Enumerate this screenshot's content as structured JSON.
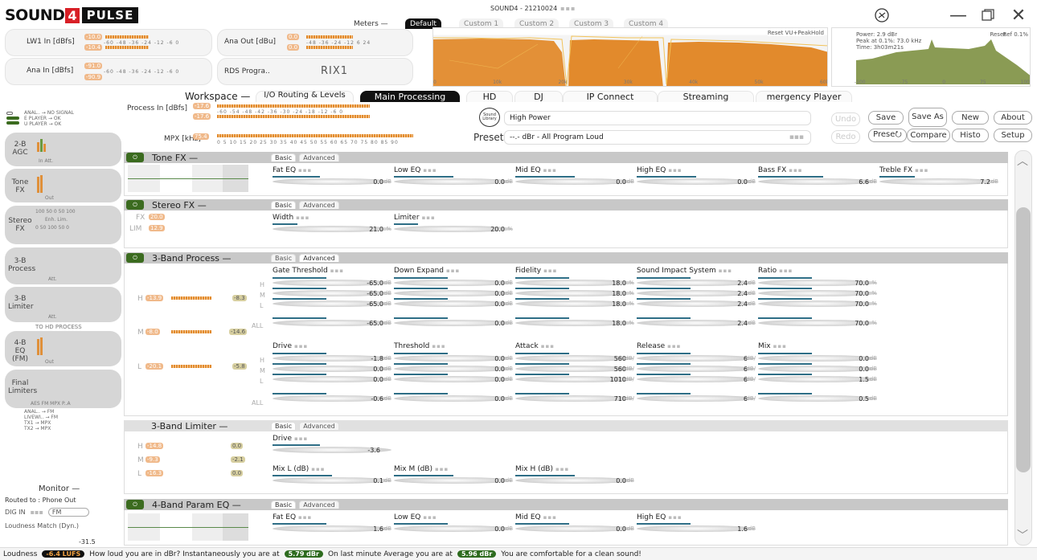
{
  "app": {
    "logo_left": "SOUND",
    "logo_four": "4",
    "logo_right": "PULSE",
    "window_title": "SOUND4 - 21210024"
  },
  "meters": {
    "lw1_label": "LW1 In [dBfs]",
    "lw1_a": "-10.0",
    "lw1_b": "-10.4",
    "ana_in_label": "Ana In [dBfs]",
    "ana_in_a": "-91.0",
    "ana_in_b": "-90.9",
    "ana_out_label": "Ana Out [dBu]",
    "ana_out_a": "0.0",
    "ana_out_b": "0.0",
    "rds_label": "RDS Progra..",
    "rds_value": "RIX1",
    "menu_label": "Meters —",
    "tabs": [
      "Default",
      "Custom 1",
      "Custom 2",
      "Custom 3",
      "Custom 4"
    ],
    "spec1_reset": "Reset VU+PeakHold",
    "spec1_x": [
      "0",
      "10k",
      "20k",
      "30k",
      "40k",
      "50k",
      "60k"
    ],
    "spec2_power": "Power: 2.9 dBr",
    "spec2_peak": "Peak at 0.1%: 73.0 kHz",
    "spec2_time": "Time: 3h03m21s",
    "spec2_reset": "Reset",
    "spec2_ref": "Ref 0.1%",
    "spec2_x": [
      "-100",
      "-75",
      "0",
      "75",
      "100"
    ]
  },
  "workspace": {
    "label": "Workspace —",
    "tabs": [
      "I/O Routing & Levels",
      "Main Processing",
      "HD",
      "DJ",
      "IP Connect",
      "Streaming",
      "mergency Player"
    ],
    "active": "Main Processing"
  },
  "process": {
    "process_in": "Process In [dBfs]",
    "pi_a": "-17.6",
    "pi_b": "-17.6",
    "mpx_label": "MPX [kHz]",
    "mpx_val": "75.4",
    "library_label": "Sound Library",
    "library_value": "High Power",
    "preset_label": "Preset",
    "preset_value": "--.- dBr - All Program Loud"
  },
  "buttons": {
    "undo": "Undo",
    "redo": "Redo",
    "save": "Save",
    "save_as": "Save As",
    "preset": "Prese⭮",
    "compare": "Compare",
    "new": "New",
    "histo": "Histo",
    "about": "About",
    "setup": "Setup"
  },
  "left": {
    "routing_top": [
      "ANAL.. → NO SIGNAL",
      "E PLAYER → OK",
      "U PLAYER → OK"
    ],
    "blocks": [
      {
        "title": "2-B AGC",
        "foot": "In    Att."
      },
      {
        "title": "Tone FX",
        "foot": "Out"
      },
      {
        "title": "Stereo FX",
        "foot": "Enh.  Lim."
      },
      {
        "title": "3-B Process",
        "foot": "Att."
      },
      {
        "title": "3-B Limiter",
        "foot": "Att."
      },
      {
        "title": "4-B EQ (FM)",
        "foot": "Out"
      },
      {
        "title": "Final Limiters",
        "foot": "AES FM   MPX P..A"
      }
    ],
    "to_hd": "TO HD PROCESS",
    "routing_bottom": [
      "ANAL.. → FM",
      "LIVEWI.. → FM",
      "TX1 → MPX",
      "TX2 → MPX"
    ]
  },
  "monitor": {
    "label": "Monitor —",
    "routed": "Routed to : Phone Out",
    "dig_in": "DIG IN",
    "fm": "FM",
    "loudness": "Loudness Match (Dyn.)",
    "level": "-31.5"
  },
  "tone_fx": {
    "title": "Tone FX —",
    "subtabs": [
      "Basic",
      "Advanced"
    ],
    "params": [
      {
        "label": "Fat EQ",
        "value": "0.0",
        "unit": "dB",
        "fill": 0.4
      },
      {
        "label": "Low EQ",
        "value": "0.0",
        "unit": "dB",
        "fill": 0.5
      },
      {
        "label": "Mid EQ",
        "value": "0.0",
        "unit": "dB",
        "fill": 0.5
      },
      {
        "label": "High EQ",
        "value": "0.0",
        "unit": "dB",
        "fill": 0.5
      },
      {
        "label": "Bass FX",
        "value": "6.6",
        "unit": "dB",
        "fill": 0.55
      },
      {
        "label": "Treble FX",
        "value": "7.2",
        "unit": "dB",
        "fill": 0.3
      }
    ]
  },
  "stereo_fx": {
    "title": "Stereo FX —",
    "subtabs": [
      "Basic",
      "Advanced"
    ],
    "fx_label": "FX",
    "fx_val": "20.0",
    "lim_label": "LIM",
    "lim_val": "12.9",
    "params": [
      {
        "label": "Width",
        "value": "21.0",
        "unit": "%",
        "fill": 0.21
      },
      {
        "label": "Limiter",
        "value": "20.0",
        "unit": "%",
        "fill": 0.2
      }
    ]
  },
  "band3_process": {
    "title": "3-Band Process —",
    "subtabs": [
      "Basic",
      "Advanced"
    ],
    "row_labels": [
      "H",
      "M",
      "L",
      "ALL"
    ],
    "h_val": "-13.9",
    "h_gain": "-8.3",
    "m_val": "-8.0",
    "m_gain": "-14.6",
    "l_val": "-20.1",
    "l_gain": "-5.8",
    "group1": [
      {
        "label": "Gate Threshold",
        "values": [
          "-65.0",
          "-65.0",
          "-65.0",
          "-65.0"
        ],
        "unit": "dB"
      },
      {
        "label": "Down Expand",
        "values": [
          "0.0",
          "0.0",
          "0.0",
          "0.0"
        ],
        "unit": "dB"
      },
      {
        "label": "Fidelity",
        "values": [
          "18.0",
          "18.0",
          "18.0",
          "18.0"
        ],
        "unit": "%"
      },
      {
        "label": "Sound Impact System",
        "values": [
          "2.4",
          "2.4",
          "2.4",
          "2.4"
        ],
        "unit": "dB"
      },
      {
        "label": "Ratio",
        "values": [
          "70.0",
          "70.0",
          "70.0",
          "70.0"
        ],
        "unit": "%"
      }
    ],
    "group2": [
      {
        "label": "Drive",
        "values": [
          "-1.8",
          "0.0",
          "0.0",
          "-0.6"
        ],
        "unit": "dB"
      },
      {
        "label": "Threshold",
        "values": [
          "0.0",
          "0.0",
          "0.0",
          "0.0"
        ],
        "unit": "dB"
      },
      {
        "label": "Attack",
        "values": [
          "560",
          "560",
          "1010",
          "710"
        ],
        "unit": "dB/"
      },
      {
        "label": "Release",
        "values": [
          "6",
          "6",
          "6",
          "6"
        ],
        "unit": "dB/"
      },
      {
        "label": "Mix",
        "values": [
          "0.0",
          "0.0",
          "1.5",
          "0.5"
        ],
        "unit": "dB"
      }
    ]
  },
  "band3_limiter": {
    "title": "3-Band Limiter —",
    "subtabs": [
      "Basic",
      "Advanced"
    ],
    "h_val": "-14.8",
    "h_gain": "0.0",
    "m_val": "-9.3",
    "m_gain": "-2.1",
    "l_val": "-16.3",
    "l_gain": "0.0",
    "drive_label": "Drive",
    "drive_value": "-3.6",
    "mix_params": [
      {
        "label": "Mix L (dB)",
        "value": "0.1",
        "unit": "dB"
      },
      {
        "label": "Mix M (dB)",
        "value": "0.0",
        "unit": "dB"
      },
      {
        "label": "Mix H (dB)",
        "value": "0.0",
        "unit": "dB"
      }
    ]
  },
  "band4_eq": {
    "title": "4-Band Param EQ —",
    "subtabs": [
      "Basic",
      "Advanced"
    ],
    "params": [
      {
        "label": "Fat EQ",
        "value": "1.6",
        "unit": "dB"
      },
      {
        "label": "Low EQ",
        "value": "0.0",
        "unit": "dB"
      },
      {
        "label": "Mid EQ",
        "value": "0.0",
        "unit": "dB"
      },
      {
        "label": "High EQ",
        "value": "1.6",
        "unit": "dB"
      }
    ]
  },
  "status": {
    "loudness_label": "Loudness",
    "loudness_value": "-6.4 LUFS",
    "t1": "How loud you are in dBr? Instantaneously you are at",
    "inst": "5.79 dBr",
    "t2": "On last minute Average you are at",
    "avg": "5.96 dBr",
    "t3": "You are comfortable for a clean sound!"
  },
  "colors": {
    "accent": "#e28a2c",
    "dark": "#111111",
    "green": "#3b6b1f",
    "slider_fill": "#2e6e86"
  }
}
